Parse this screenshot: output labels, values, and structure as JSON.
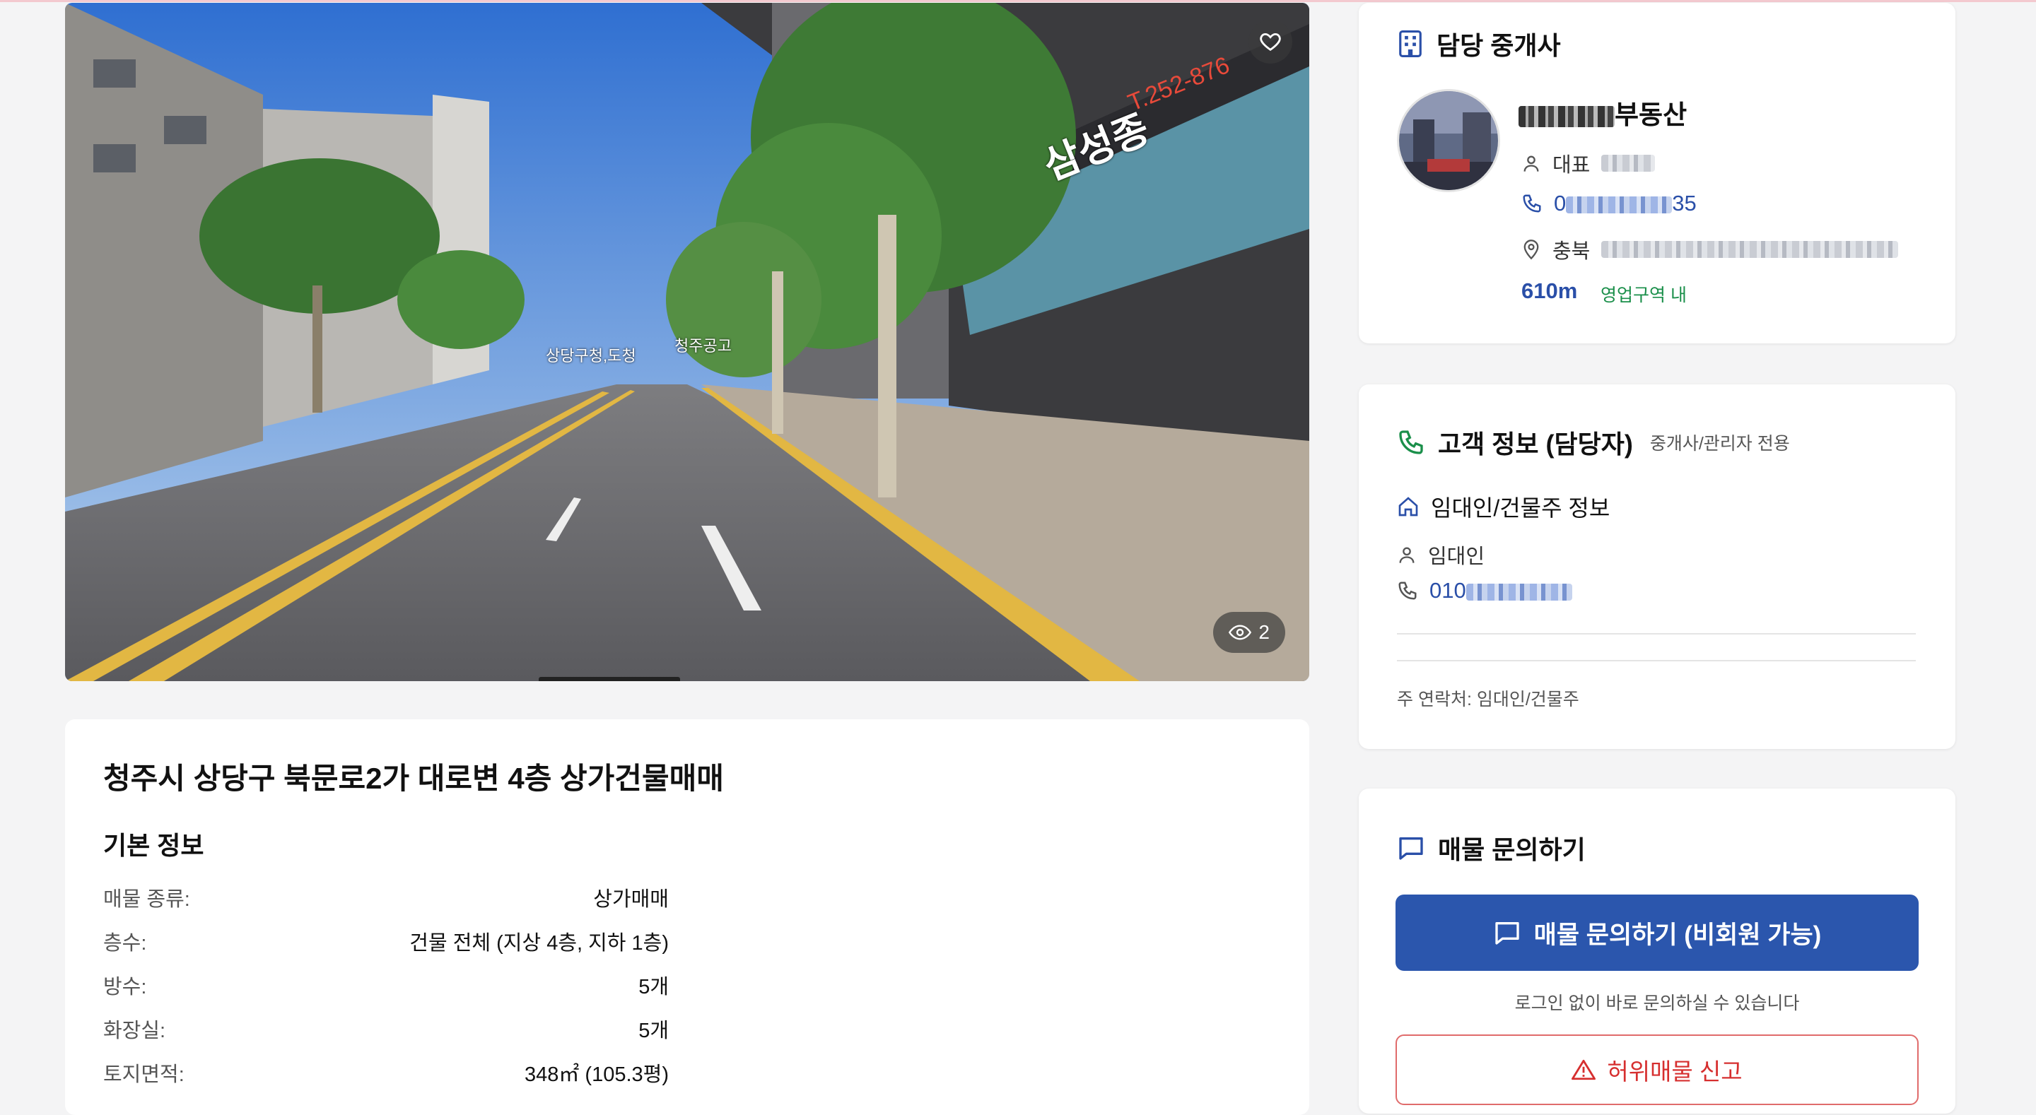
{
  "photo": {
    "view_count": "2",
    "sign_left": "상당구청,도청",
    "sign_right": "청주공고",
    "building_sign": "삼성종",
    "building_phone": "T.252-876",
    "icons": {
      "favorite": "heart-icon",
      "views": "eye-icon"
    }
  },
  "listing": {
    "title": "청주시 상당구 북문로2가 대로변 4층 상가건물매매",
    "section_title": "기본 정보",
    "info": [
      {
        "label": "매물 종류:",
        "value": "상가매매"
      },
      {
        "label": "층수:",
        "value": "건물 전체 (지상 4층, 지하 1층)"
      },
      {
        "label": "방수:",
        "value": "5개"
      },
      {
        "label": "화장실:",
        "value": "5개"
      },
      {
        "label": "토지면적:",
        "value": "348㎡ (105.3평)"
      }
    ]
  },
  "agent": {
    "heading": "담당 중개사",
    "agency_suffix": "부동산",
    "rep_label": "대표",
    "phone_prefix": "0",
    "phone_suffix": "35",
    "address_prefix": "충북",
    "distance": "610m",
    "zone_label": "영업구역 내"
  },
  "customer": {
    "heading": "고객 정보 (담당자)",
    "subheading": "중개사/관리자 전용",
    "owner_section": "임대인/건물주 정보",
    "owner_role": "임대인",
    "owner_phone_prefix": "010",
    "main_contact": "주 연락처: 임대인/건물주"
  },
  "inquiry": {
    "heading": "매물 문의하기",
    "button_label": "매물 문의하기 (비회원 가능)",
    "hint": "로그인 없이 바로 문의하실 수 있습니다",
    "report_label": "허위매물 신고"
  },
  "colors": {
    "accent": "#2b56ad",
    "link": "#2a4fa8",
    "zone": "#1a8f4a",
    "danger": "#d62f2f"
  }
}
